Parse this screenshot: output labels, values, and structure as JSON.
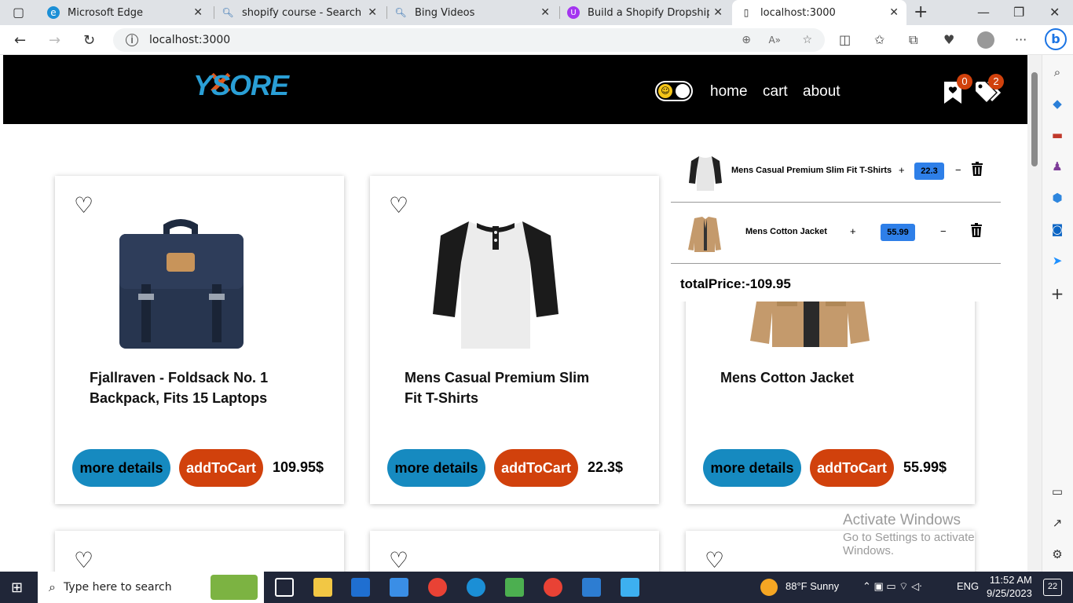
{
  "browser": {
    "tabs": [
      {
        "title": "Microsoft Edge",
        "icon": "edge-icon"
      },
      {
        "title": "shopify course - Search",
        "icon": "search-icon"
      },
      {
        "title": "Bing Videos",
        "icon": "search-icon"
      },
      {
        "title": "Build a Shopify Dropshipping",
        "icon": "udemy-icon"
      },
      {
        "title": "localhost:3000",
        "icon": "page-icon"
      }
    ],
    "url": "localhost:3000"
  },
  "site": {
    "logo": "YSORE",
    "nav": {
      "home": "home",
      "cart": "cart",
      "about": "about"
    },
    "wishlist_count": "0",
    "cart_count": "2",
    "products": [
      {
        "title": "Fjallraven - Foldsack No. 1 Backpack, Fits 15 Laptops",
        "price": "109.95$"
      },
      {
        "title": "Mens Casual Premium Slim Fit T-Shirts",
        "price": "22.3$"
      },
      {
        "title": "Mens Cotton Jacket",
        "price": "55.99$"
      }
    ],
    "buttons": {
      "more": "more details",
      "add": "addToCart"
    },
    "cart": {
      "items": [
        {
          "name": "Mens Casual Premium Slim Fit T-Shirts",
          "price": "22.3",
          "plus": "+",
          "minus": "−"
        },
        {
          "name": "Mens Cotton Jacket",
          "price": "55.99",
          "plus": "+",
          "minus": "−"
        }
      ],
      "total": "totalPrice:-109.95"
    }
  },
  "watermark": {
    "line1": "Activate Windows",
    "line2": "Go to Settings to activate Windows."
  },
  "taskbar": {
    "search_placeholder": "Type here to search",
    "weather": "88°F  Sunny",
    "lang": "ENG",
    "time": "11:52 AM",
    "date": "9/25/2023",
    "notifications": "22"
  },
  "colors": {
    "accent_blue": "#168ac0",
    "accent_orange": "#d1410c",
    "cart_price_bg": "#2e7fe8"
  }
}
